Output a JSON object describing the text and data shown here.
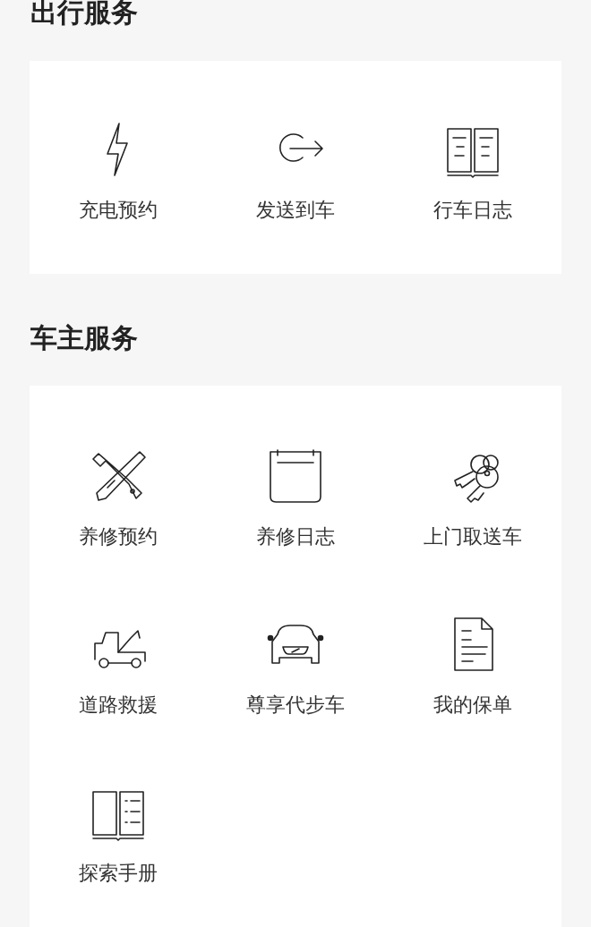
{
  "sections": [
    {
      "title": "出行服务",
      "items": [
        {
          "label": "充电预约"
        },
        {
          "label": "发送到车"
        },
        {
          "label": "行车日志"
        }
      ]
    },
    {
      "title": "车主服务",
      "items": [
        {
          "label": "养修预约"
        },
        {
          "label": "养修日志"
        },
        {
          "label": "上门取送车"
        },
        {
          "label": "道路救援"
        },
        {
          "label": "尊享代步车"
        },
        {
          "label": "我的保单"
        },
        {
          "label": "探索手册"
        }
      ]
    }
  ]
}
